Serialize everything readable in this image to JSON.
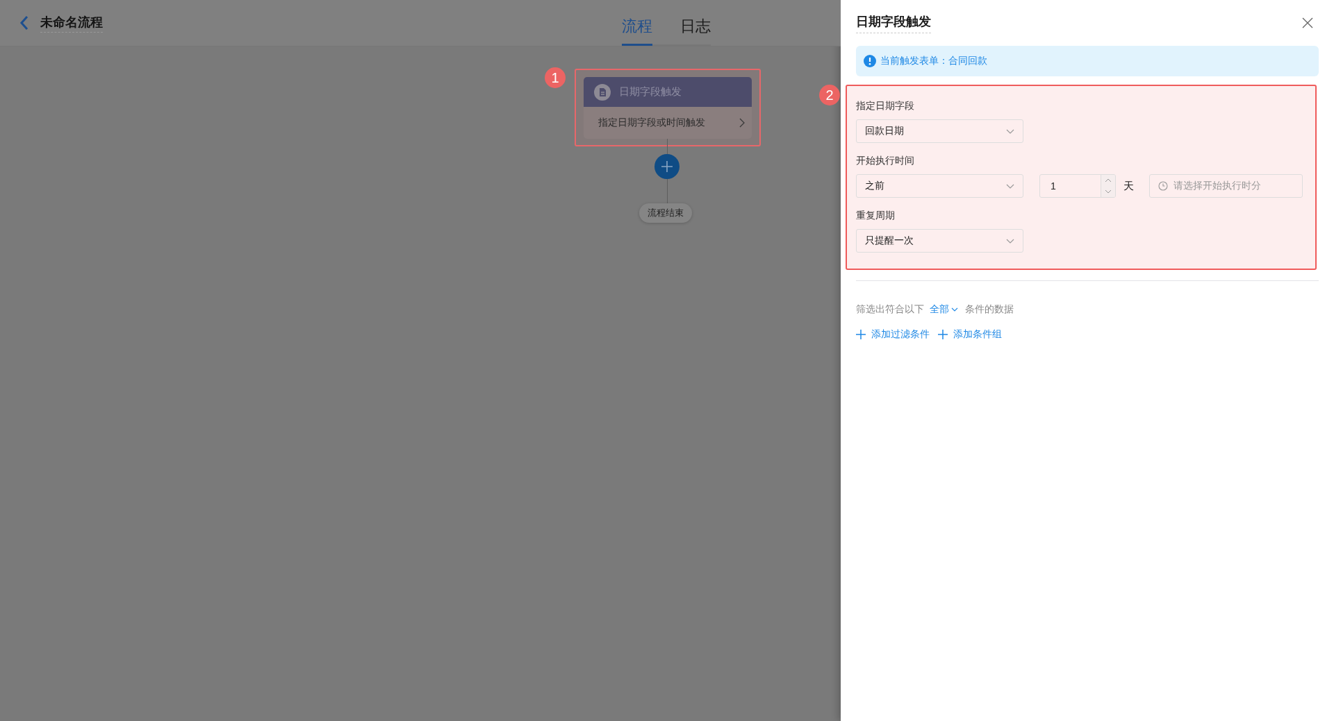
{
  "header": {
    "title": "未命名流程",
    "tabs": [
      {
        "label": "流程",
        "selected": true
      },
      {
        "label": "日志",
        "selected": false
      }
    ]
  },
  "canvas": {
    "annotation": "1",
    "trigger_node": {
      "title": "日期字段触发",
      "description": "指定日期字段或时间触发"
    },
    "end_node": {
      "label": "流程结束"
    }
  },
  "drawer": {
    "title": "日期字段触发",
    "notice": "当前触发表单：合同回款",
    "annotation": "2",
    "fields": [
      {
        "kind": "select",
        "label": "指定日期字段",
        "value": "回款日期"
      },
      {
        "kind": "offset",
        "label": "开始执行时间",
        "value": "之前",
        "amount": "1",
        "unit": "天",
        "time_placeholder": "请选择开始执行时分"
      },
      {
        "kind": "select",
        "label": "重复周期",
        "value": "只提醒一次"
      }
    ],
    "filter": {
      "prefix": "筛选出符合以下",
      "mode": "全部",
      "suffix": "条件的数据",
      "actions": [
        "添加过滤条件",
        "添加条件组"
      ]
    }
  }
}
